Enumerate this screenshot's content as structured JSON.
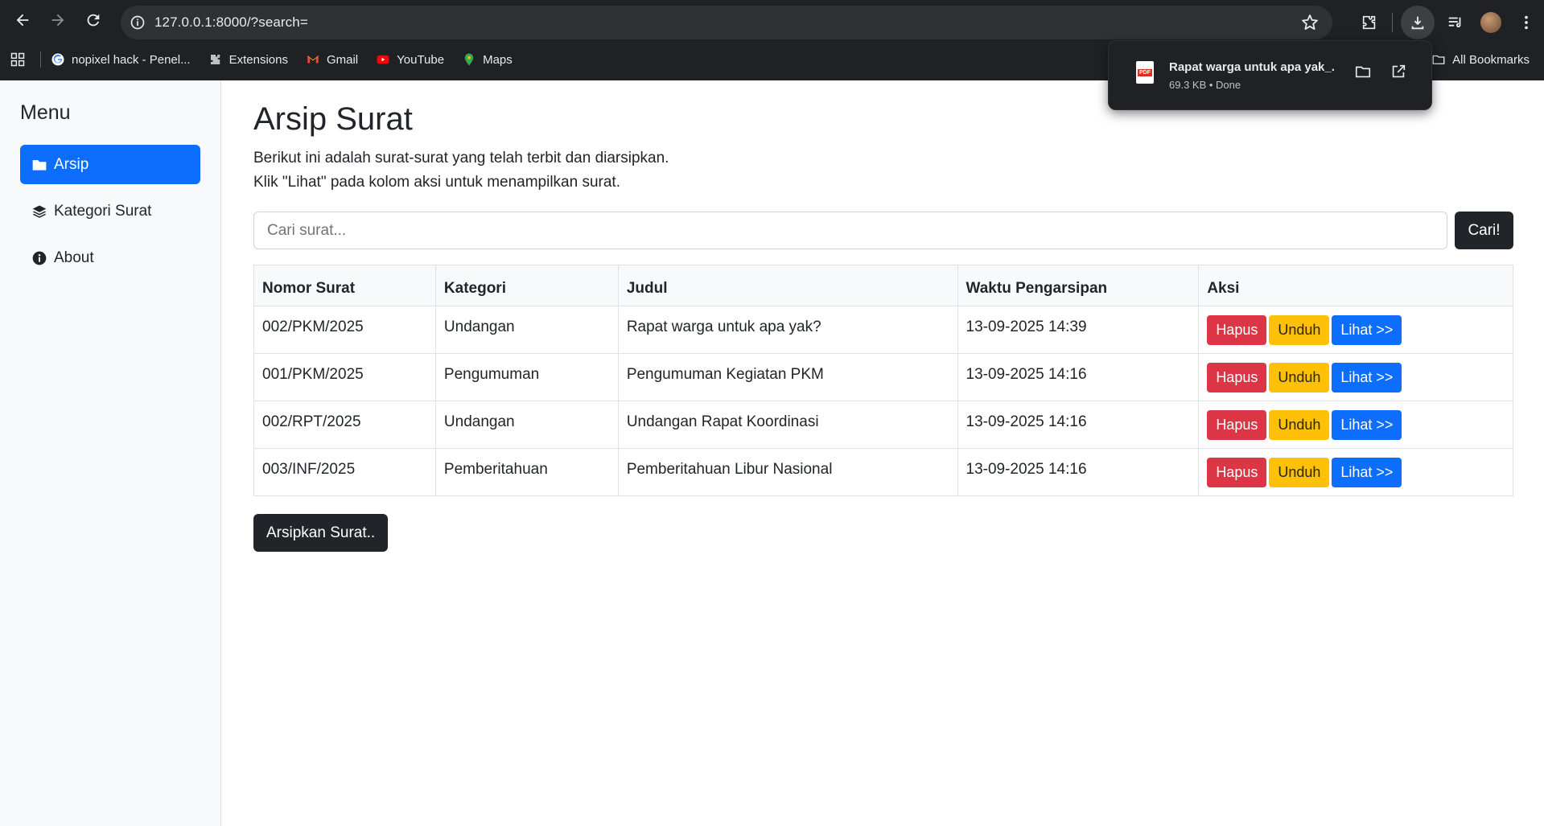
{
  "browser": {
    "url": "127.0.0.1:8000/?search=",
    "bookmarks": [
      {
        "label": "nopixel hack - Penel...",
        "icon": "google-icon"
      },
      {
        "label": "Extensions",
        "icon": "puzzle-icon"
      },
      {
        "label": "Gmail",
        "icon": "gmail-icon"
      },
      {
        "label": "YouTube",
        "icon": "youtube-icon"
      },
      {
        "label": "Maps",
        "icon": "maps-icon"
      }
    ],
    "all_bookmarks": "All Bookmarks"
  },
  "download": {
    "filename": "Rapat warga untuk apa yak_.",
    "meta": "69.3 KB • Done",
    "file_badge": "PDF"
  },
  "sidebar": {
    "title": "Menu",
    "items": [
      {
        "label": "Arsip",
        "icon": "folder-icon",
        "active": true
      },
      {
        "label": "Kategori Surat",
        "icon": "layers-icon",
        "active": false
      },
      {
        "label": "About",
        "icon": "info-icon",
        "active": false
      }
    ]
  },
  "main": {
    "title": "Arsip Surat",
    "desc_line1": "Berikut ini adalah surat-surat yang telah terbit dan diarsipkan.",
    "desc_line2": "Klik \"Lihat\" pada kolom aksi untuk menampilkan surat.",
    "search_placeholder": "Cari surat...",
    "search_value": "",
    "search_button": "Cari!",
    "archive_button": "Arsipkan Surat.."
  },
  "table": {
    "headers": [
      "Nomor Surat",
      "Kategori",
      "Judul",
      "Waktu Pengarsipan",
      "Aksi"
    ],
    "rows": [
      {
        "nomor": "002/PKM/2025",
        "kategori": "Undangan",
        "judul": "Rapat warga untuk apa yak?",
        "waktu": "13-09-2025 14:39"
      },
      {
        "nomor": "001/PKM/2025",
        "kategori": "Pengumuman",
        "judul": "Pengumuman Kegiatan PKM",
        "waktu": "13-09-2025 14:16"
      },
      {
        "nomor": "002/RPT/2025",
        "kategori": "Undangan",
        "judul": "Undangan Rapat Koordinasi",
        "waktu": "13-09-2025 14:16"
      },
      {
        "nomor": "003/INF/2025",
        "kategori": "Pemberitahuan",
        "judul": "Pemberitahuan Libur Nasional",
        "waktu": "13-09-2025 14:16"
      }
    ],
    "actions": {
      "delete": "Hapus",
      "download": "Unduh",
      "view": "Lihat >>"
    }
  },
  "colors": {
    "primary": "#0d6efd",
    "danger": "#dc3545",
    "warning": "#ffc107",
    "dark": "#212529",
    "chrome": "#202124"
  }
}
